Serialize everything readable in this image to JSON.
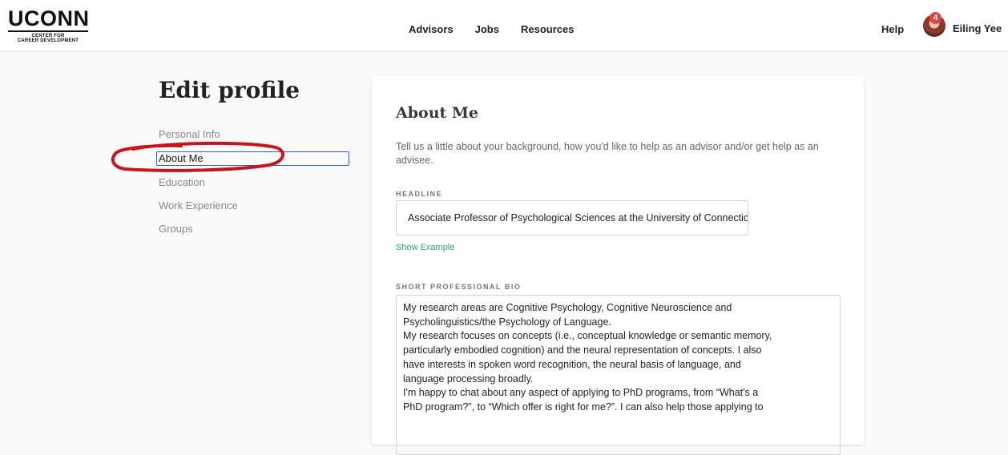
{
  "header": {
    "logo_main": "UCONN",
    "logo_sub_1": "CENTER FOR",
    "logo_sub_2": "CAREER DEVELOPMENT",
    "nav": [
      "Advisors",
      "Jobs",
      "Resources"
    ],
    "help_label": "Help",
    "notification_count": "4",
    "user_name": "Eiling Yee"
  },
  "sidebar": {
    "title": "Edit profile",
    "items": [
      {
        "label": "Personal Info",
        "active": false
      },
      {
        "label": "About Me",
        "active": true
      },
      {
        "label": "Education",
        "active": false
      },
      {
        "label": "Work Experience",
        "active": false
      },
      {
        "label": "Groups",
        "active": false
      }
    ]
  },
  "about": {
    "title": "About Me",
    "description": "Tell us a little about your background, how you'd like to help as an advisor and/or get help as an advisee.",
    "headline_label": "HEADLINE",
    "headline_value": "Associate Professor of Psychological Sciences at the University of Connecticut",
    "show_example": "Show Example",
    "bio_label": "SHORT PROFESSIONAL BIO",
    "bio_lines": [
      "My research areas are Cognitive Psychology, Cognitive Neuroscience and",
      "Psycholinguistics/the Psychology of Language.",
      "My research focuses on concepts (i.e., conceptual knowledge or semantic memory,",
      "particularly embodied cognition) and the neural representation of concepts. I also",
      "have interests in spoken word recognition, the neural basis of language, and",
      "language processing broadly.",
      "I'm happy to chat about any aspect of applying to PhD programs, from “What's a",
      "PhD program?\", to “Which offer is right for me?”. I can also help those applying to"
    ]
  },
  "colors": {
    "accent_green": "#2ea55f",
    "focus_blue": "#2a5fd1",
    "annotation_red": "#c4161c",
    "badge_red": "#e0463c"
  }
}
